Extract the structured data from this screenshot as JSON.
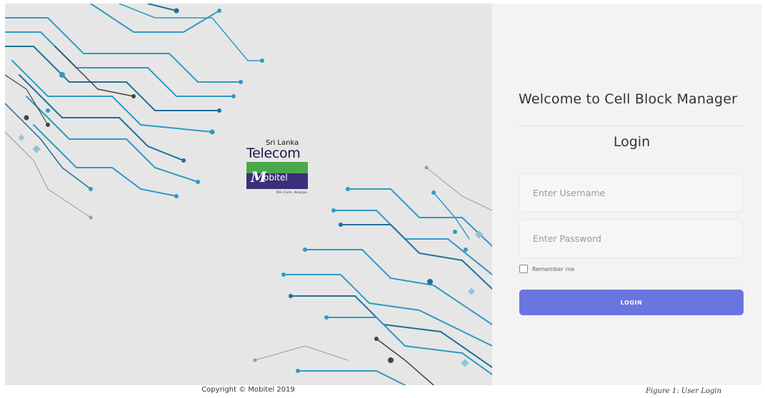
{
  "brand": {
    "telecom_top": "Sri Lanka",
    "telecom_main": "Telecom",
    "mobitel_initial": "M",
    "mobitel_rest": "obitel",
    "tagline": "We Care. Always."
  },
  "login_panel": {
    "welcome": "Welcome to Cell Block Manager",
    "title": "Login",
    "username_placeholder": "Enter Username",
    "username_value": "",
    "password_placeholder": "Enter Password",
    "password_value": "",
    "remember_label": "Remember me",
    "remember_checked": false,
    "login_button": "LOGIN"
  },
  "colors": {
    "accent": "#6a76e0",
    "circuit": "#2d9bc4",
    "hero_bg": "#e6e6e6",
    "panel_bg": "#f3f3f3"
  },
  "footer": {
    "copyright": "Copyright © Mobitel 2019",
    "caption": "Figure 1: User Login"
  }
}
